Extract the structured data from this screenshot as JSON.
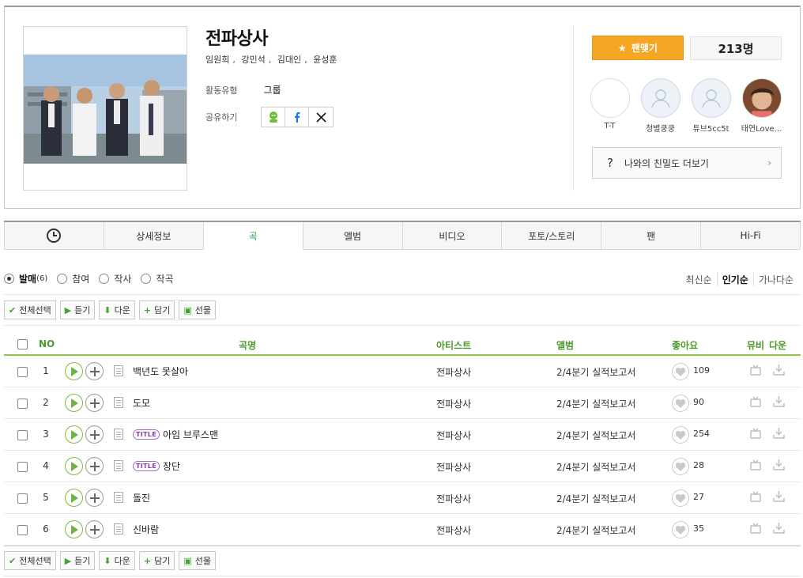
{
  "artist": {
    "name": "전파상사",
    "members": [
      "임원희",
      "강민석",
      "김대인",
      "윤성훈"
    ],
    "info": [
      {
        "label": "활동유형",
        "value": "그룹"
      },
      {
        "label": "공유하기",
        "value": ""
      }
    ],
    "share_icons": [
      "kakao-icon",
      "facebook-icon",
      "x-icon"
    ]
  },
  "fan": {
    "button_label": "팬맺기",
    "count": "213명",
    "fans": [
      {
        "name": "T-T",
        "avatar": "blank"
      },
      {
        "name": "청별쿵쿵",
        "avatar": "default"
      },
      {
        "name": "튜브5cc5t",
        "avatar": "default"
      },
      {
        "name": "태연Love...",
        "avatar": "photo"
      }
    ],
    "affinity_label": "나와의 친밀도 더보기",
    "affinity_q": "?",
    "affinity_chevron": "›"
  },
  "tabs": [
    {
      "label": "",
      "icon": "clock-icon"
    },
    {
      "label": "상세정보"
    },
    {
      "label": "곡",
      "active": true
    },
    {
      "label": "앨범"
    },
    {
      "label": "비디오"
    },
    {
      "label": "포토/스토리"
    },
    {
      "label": "팬"
    },
    {
      "label": "Hi-Fi"
    }
  ],
  "filter": {
    "options": [
      {
        "label": "발매",
        "count": "(6)",
        "selected": true
      },
      {
        "label": "참여",
        "count": ""
      },
      {
        "label": "작사",
        "count": ""
      },
      {
        "label": "작곡",
        "count": ""
      }
    ],
    "sort": [
      "최신순",
      "인기순",
      "가나다순"
    ],
    "sort_active": "인기순"
  },
  "actions": {
    "select_all": "전체선택",
    "listen": "듣기",
    "download": "다운",
    "add": "담기",
    "gift": "선물"
  },
  "table": {
    "headers": {
      "no": "NO",
      "title": "곡명",
      "artist": "아티스트",
      "album": "앨범",
      "likes": "좋아요",
      "mv": "뮤비",
      "dl": "다운"
    },
    "rows": [
      {
        "no": "1",
        "title": "백년도 못살아",
        "badge": "",
        "artist": "전파상사",
        "album": "2/4분기 실적보고서",
        "likes": "109"
      },
      {
        "no": "2",
        "title": "도모",
        "badge": "",
        "artist": "전파상사",
        "album": "2/4분기 실적보고서",
        "likes": "90"
      },
      {
        "no": "3",
        "title": "아임 브루스맨",
        "badge": "TITLE",
        "artist": "전파상사",
        "album": "2/4분기 실적보고서",
        "likes": "254"
      },
      {
        "no": "4",
        "title": "장단",
        "badge": "TITLE",
        "artist": "전파상사",
        "album": "2/4분기 실적보고서",
        "likes": "28"
      },
      {
        "no": "5",
        "title": "돌진",
        "badge": "",
        "artist": "전파상사",
        "album": "2/4분기 실적보고서",
        "likes": "27"
      },
      {
        "no": "6",
        "title": "신바람",
        "badge": "",
        "artist": "전파상사",
        "album": "2/4분기 실적보고서",
        "likes": "35"
      }
    ]
  },
  "colors": {
    "accent_green": "#1aa34a",
    "fan_orange": "#f5a623",
    "header_green": "#4b9b29"
  }
}
